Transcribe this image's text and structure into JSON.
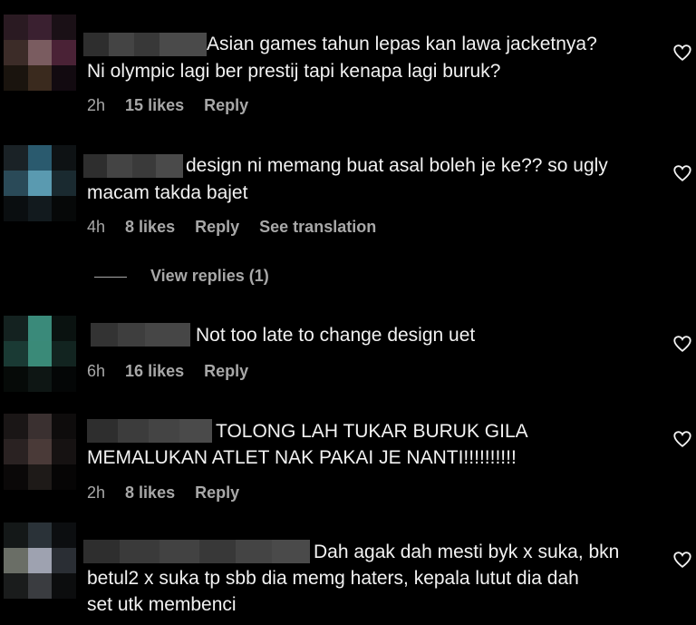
{
  "comments": [
    {
      "text_line1": "Asian games tahun lepas kan lawa jacketnya?",
      "text_line2": "Ni olympic lagi ber prestij tapi kenapa lagi buruk?",
      "time": "2h",
      "likes": "15 likes",
      "reply": "Reply"
    },
    {
      "text_line1": "design ni memang buat asal boleh je ke?? so ugly",
      "text_line2": "macam takda bajet",
      "time": "4h",
      "likes": "8 likes",
      "reply": "Reply",
      "see_translation": "See translation"
    },
    {
      "text_line1": "Not too late to change design uet",
      "time": "6h",
      "likes": "16 likes",
      "reply": "Reply"
    },
    {
      "text_line1": "TOLONG LAH TUKAR BURUK GILA",
      "text_line2": "MEMALUKAN ATLET NAK PAKAI JE NANTI!!!!!!!!!!",
      "time": "2h",
      "likes": "8 likes",
      "reply": "Reply"
    },
    {
      "text_line1": "Dah agak dah mesti byk x suka, bkn",
      "text_line2": "betul2 x suka tp sbb dia memg haters, kepala lutut dia dah",
      "text_line3": "set utk membenci"
    }
  ],
  "view_replies": "View replies (1)",
  "icons": {
    "like": "heart-outline-icon"
  },
  "colors": {
    "background": "#000000",
    "text": "#f2f2f2",
    "meta": "#a8a8a8"
  }
}
